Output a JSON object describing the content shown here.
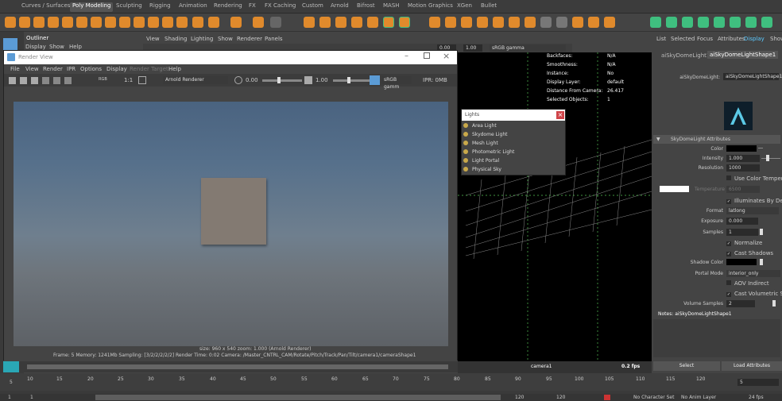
{
  "shelf_tabs": [
    "Curves / Surfaces",
    "Poly Modeling",
    "Sculpting",
    "Rigging",
    "Animation",
    "Rendering",
    "FX",
    "FX Caching",
    "Custom",
    "Arnold",
    "Bifrost",
    "MASH",
    "Motion Graphics",
    "XGen",
    "Bullet"
  ],
  "active_shelf_tab": "Poly Modeling",
  "outliner": {
    "title": "Outliner",
    "menu": [
      "Display",
      "Show",
      "Help"
    ]
  },
  "viewport": {
    "menu": [
      "View",
      "Shading",
      "Lighting",
      "Show",
      "Renderer",
      "Panels"
    ],
    "exposure": "0.00",
    "gamma": "1.00",
    "color_space": "sRGB gamma",
    "hud": [
      {
        "label": "Backfaces:",
        "value": "N/A"
      },
      {
        "label": "Smoothness:",
        "value": "N/A"
      },
      {
        "label": "Instance:",
        "value": "No"
      },
      {
        "label": "Display Layer:",
        "value": "default"
      },
      {
        "label": "Distance From Camera:",
        "value": "26.417"
      },
      {
        "label": "Selected Objects:",
        "value": "1"
      }
    ],
    "camera": "camera1",
    "fps": "0.2 fps"
  },
  "render_view": {
    "title": "Render View",
    "menu": [
      "File",
      "View",
      "Render",
      "IPR",
      "Options",
      "Display",
      "Render Target",
      "Help"
    ],
    "renderer": "Arnold Renderer",
    "exposure": "0.00",
    "gamma": "1.00",
    "color_space": "sRGB gamm",
    "ipr": "IPR: 0MB",
    "rgb_label": "RGB",
    "ratio": "1:1",
    "size_info": "size: 960 x 540  zoom: 1.000     (Arnold Renderer)",
    "status": "Frame: 5     Memory: 1241Mb     Sampling: [3/2/2/2/2/2]     Render Time: 0:02     Camera: /Master_CNTRL_CAM/Rotate/Pitch/Track/Pan/Tilt/camera1/cameraShape1"
  },
  "lights_window": {
    "title": "Lights",
    "items": [
      "Area Light",
      "Skydome Light",
      "Mesh Light",
      "Photometric Light",
      "Light Portal",
      "Physical Sky"
    ]
  },
  "attribute_editor": {
    "menu": [
      "List",
      "Selected",
      "Focus",
      "Attributes",
      "Display",
      "Show"
    ],
    "tabs": [
      "aiSkyDomeLight1",
      "aiSkyDomeLightShape1"
    ],
    "node_label": "aiSkyDomeLight:",
    "node_value": "aiSkyDomeLightShape1",
    "section": "SkyDomeLight Attributes",
    "color_label": "Color",
    "intensity_label": "Intensity",
    "intensity": "1.000",
    "resolution_label": "Resolution",
    "resolution": "1000",
    "use_color_temp": "Use Color Temperature",
    "temperature_label": "Temperature",
    "temperature": "6500",
    "illuminates": "Illuminates By Default",
    "format_label": "Format",
    "format": "latlong",
    "exposure_label": "Exposure",
    "exposure": "0.000",
    "samples_label": "Samples",
    "samples": "1",
    "normalize": "Normalize",
    "cast_shadows": "Cast Shadows",
    "shadow_color_label": "Shadow Color",
    "portal_label": "Portal Mode",
    "portal": "interior_only",
    "aov_indirect": "AOV Indirect",
    "cast_volumetric": "Cast Volumetric Shadows",
    "volume_samples_label": "Volume Samples",
    "volume_samples": "2",
    "notes": "Notes:  aiSkyDomeLightShape1",
    "select_btn": "Select",
    "load_btn": "Load Attributes"
  },
  "timeline": {
    "ticks": [
      "5",
      "10",
      "15",
      "20",
      "25",
      "30",
      "35",
      "40",
      "45",
      "50",
      "55",
      "60",
      "65",
      "70",
      "75",
      "80",
      "85",
      "90",
      "95",
      "100",
      "105",
      "110",
      "115",
      "120"
    ],
    "current_frame": "5",
    "start": "1",
    "end_a": "120",
    "end_b": "120",
    "no_char": "No Character Set",
    "no_anim": "No Anim Layer",
    "fps": "24 fps",
    "small_a": "1",
    "small_b": "1"
  },
  "colors": {
    "accent": "#5b9bd5",
    "orange": "#e08a2c",
    "green": "#3fbf7f",
    "panel": "#444444"
  }
}
